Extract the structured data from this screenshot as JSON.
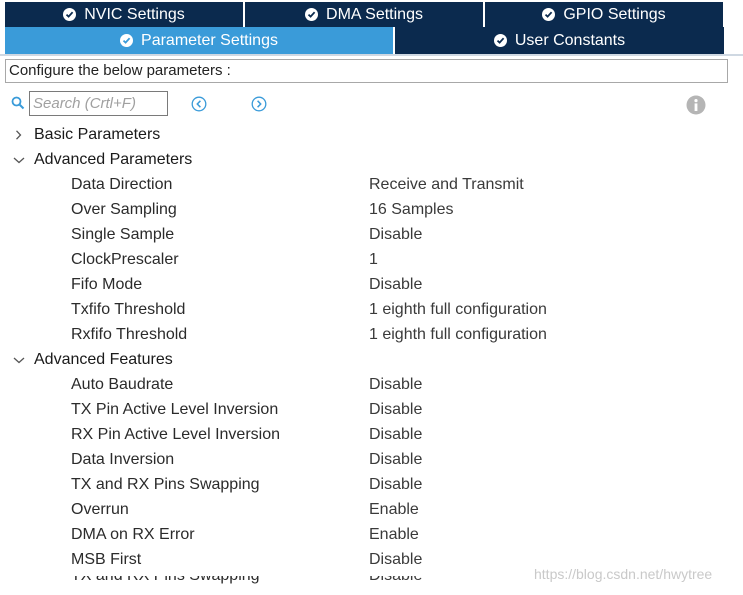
{
  "tabs": {
    "row1": [
      {
        "label": "NVIC Settings",
        "width": 240
      },
      {
        "label": "DMA Settings",
        "width": 240
      },
      {
        "label": "GPIO Settings",
        "width": 240
      }
    ],
    "row2": [
      {
        "label": "Parameter Settings",
        "width": 390,
        "active": true
      },
      {
        "label": "User Constants",
        "width": 331
      }
    ]
  },
  "description": "Configure the below parameters :",
  "search": {
    "placeholder": "Search (Crtl+F)"
  },
  "icons": {
    "search": "search-icon",
    "prev": "chevron-left-circle-icon",
    "next": "chevron-right-circle-icon",
    "info": "info-icon",
    "tab_check": "check-circle-icon"
  },
  "colors": {
    "tab_dark": "#0b2a4e",
    "tab_active": "#3a9bd9",
    "icon_blue": "#3a9bd9"
  },
  "tree": {
    "basic": {
      "label": "Basic Parameters",
      "expanded": false
    },
    "advanced_parameters": {
      "label": "Advanced Parameters",
      "expanded": true,
      "items": [
        {
          "label": "Data Direction",
          "value": "Receive and Transmit"
        },
        {
          "label": "Over Sampling",
          "value": "16 Samples"
        },
        {
          "label": "Single Sample",
          "value": "Disable"
        },
        {
          "label": "ClockPrescaler",
          "value": "1"
        },
        {
          "label": "Fifo Mode",
          "value": "Disable"
        },
        {
          "label": "Txfifo Threshold",
          "value": "1 eighth full configuration"
        },
        {
          "label": "Rxfifo Threshold",
          "value": "1 eighth full configuration"
        }
      ]
    },
    "advanced_features": {
      "label": "Advanced Features",
      "expanded": true,
      "items": [
        {
          "label": "Auto Baudrate",
          "value": "Disable"
        },
        {
          "label": "TX Pin Active Level Inversion",
          "value": "Disable"
        },
        {
          "label": "RX Pin Active Level Inversion",
          "value": "Disable"
        },
        {
          "label": "Data Inversion",
          "value": "Disable"
        },
        {
          "label": "TX and RX Pins Swapping",
          "value": "Disable"
        },
        {
          "label": "Overrun",
          "value": "Enable"
        },
        {
          "label": "DMA on RX Error",
          "value": "Enable"
        },
        {
          "label": "MSB First",
          "value": "Disable"
        }
      ],
      "partial_item": {
        "label": "TX and RX Pins Swapping",
        "value": "Disable"
      }
    }
  },
  "watermark": "https://blog.csdn.net/hwytree"
}
